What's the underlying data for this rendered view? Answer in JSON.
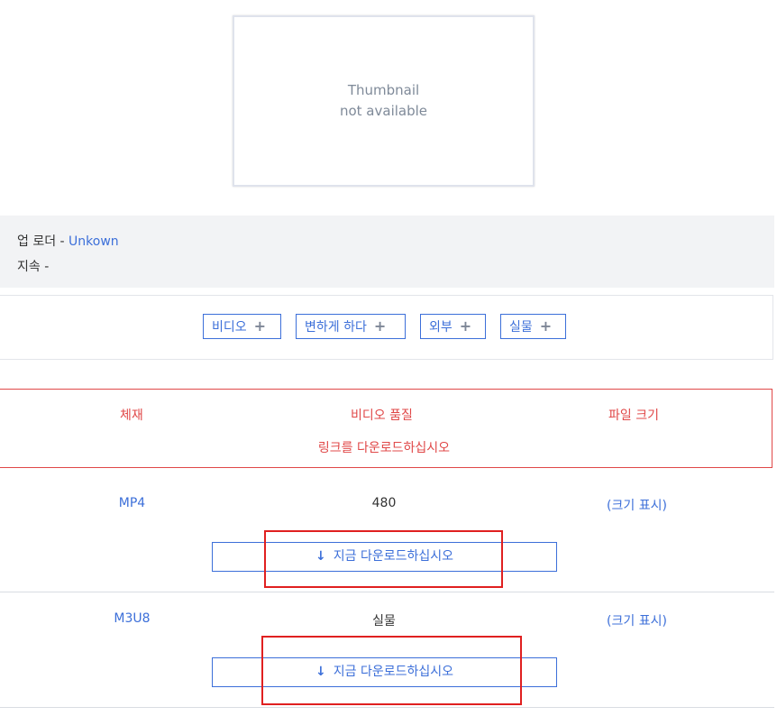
{
  "thumbnail": {
    "line1": "Thumbnail",
    "line2": "not available"
  },
  "info": {
    "uploader_label": "업 로더 - ",
    "uploader_value": "Unkown",
    "duration_label": "지속 -"
  },
  "tabs": [
    {
      "label": "비디오"
    },
    {
      "label": "변하게 하다"
    },
    {
      "label": "외부"
    },
    {
      "label": "실물"
    }
  ],
  "table_header": {
    "col_format": "체재",
    "col_quality": "비디오 품질",
    "col_size": "파일 크기",
    "subtitle": "링크를 다운로드하십시오"
  },
  "rows": [
    {
      "format": "MP4",
      "quality": "480",
      "size": "(크기 표시)",
      "button": "지금 다운로드하십시오"
    },
    {
      "format": "M3U8",
      "quality": "실물",
      "size": "(크기 표시)",
      "button": "지금 다운로드하십시오"
    }
  ],
  "colors": {
    "accent": "#3c6fd9",
    "header_red": "#e04848",
    "highlight_red": "#e02020",
    "info_bg": "#f2f3f5"
  }
}
